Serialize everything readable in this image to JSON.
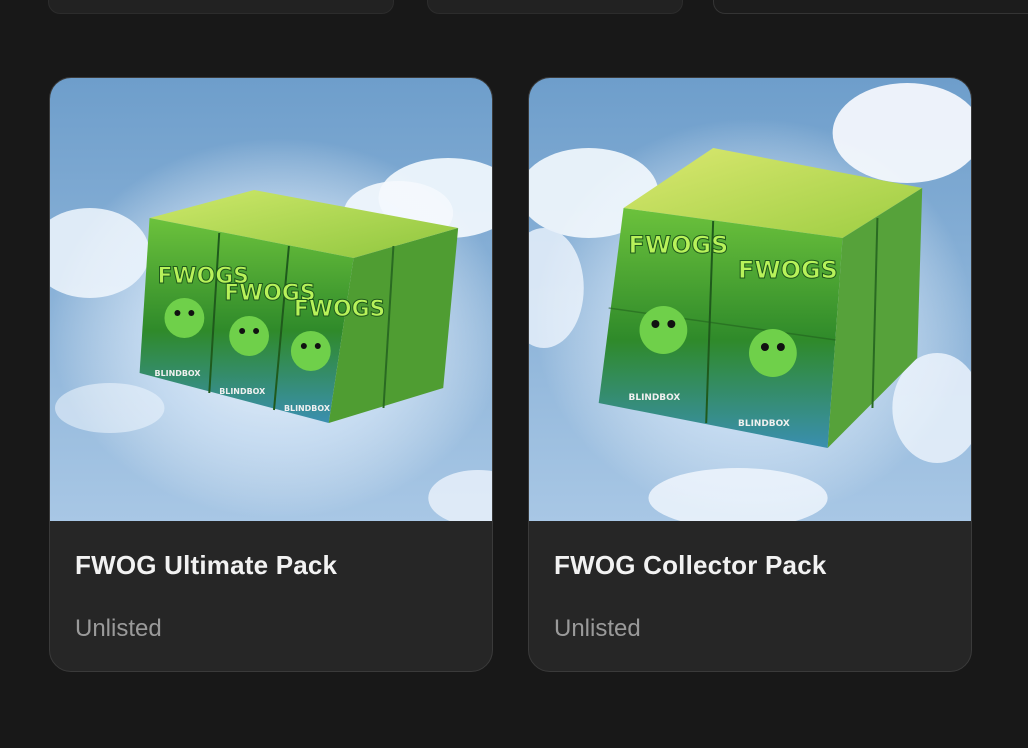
{
  "packs": [
    {
      "title": "FWOG Ultimate Pack",
      "status": "Unlisted",
      "image_name": "fwog-ultimate-pack-image",
      "box_logo_text": "FWOGS",
      "box_bottom_text": "BLINDBOX"
    },
    {
      "title": "FWOG Collector Pack",
      "status": "Unlisted",
      "image_name": "fwog-collector-pack-image",
      "box_logo_text": "FWOGS",
      "box_bottom_text": "BLINDBOX"
    }
  ],
  "colors": {
    "page_background": "#181818",
    "card_background": "#262626",
    "card_border": "#3a3a3a",
    "title_text": "#f2f2f2",
    "status_text": "#9a9a9a",
    "sky_top": "#6f9fcc",
    "sky_bottom": "#a9c8e6",
    "box_green": "#3e9a2c",
    "box_light_green": "#8fd14a"
  }
}
